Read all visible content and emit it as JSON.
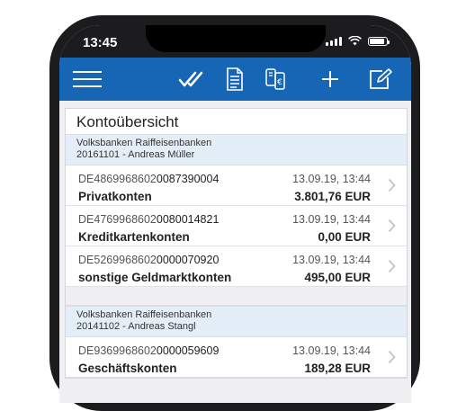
{
  "status": {
    "time": "13:45"
  },
  "toolbar": {
    "menu_icon": "hamburger-icon",
    "check_icon": "double-check-icon",
    "document_icon": "document-icon",
    "transfer_icon": "euro-transfer-icon",
    "add_icon": "plus-icon",
    "edit_icon": "edit-icon",
    "color": "#1766b5"
  },
  "overview": {
    "title": "Kontoübersicht",
    "groups": [
      {
        "bank": "Volksbanken Raiffeisenbanken",
        "owner": "20161101 - Andreas Müller",
        "accounts": [
          {
            "iban_prefix": "DE4869968602",
            "iban_suffix": "0087390004",
            "name": "Privatkonten",
            "date": "13.09.19, 13:44",
            "amount": "3.801,76 EUR"
          },
          {
            "iban_prefix": "DE4769968602",
            "iban_suffix": "0080014821",
            "name": "Kreditkartenkonten",
            "date": "13.09.19, 13:44",
            "amount": "0,00 EUR"
          },
          {
            "iban_prefix": "DE5269968602",
            "iban_suffix": "0000070920",
            "name": "sonstige Geldmarktkonten",
            "date": "13.09.19, 13:44",
            "amount": "495,00 EUR"
          }
        ]
      },
      {
        "bank": "Volksbanken Raiffeisenbanken",
        "owner": "20141102 - Andreas Stangl",
        "accounts": [
          {
            "iban_prefix": "DE9369968602",
            "iban_suffix": "0000059609",
            "name": "Geschäftskonten",
            "date": "13.09.19, 13:44",
            "amount": "189,28 EUR"
          }
        ]
      }
    ]
  }
}
